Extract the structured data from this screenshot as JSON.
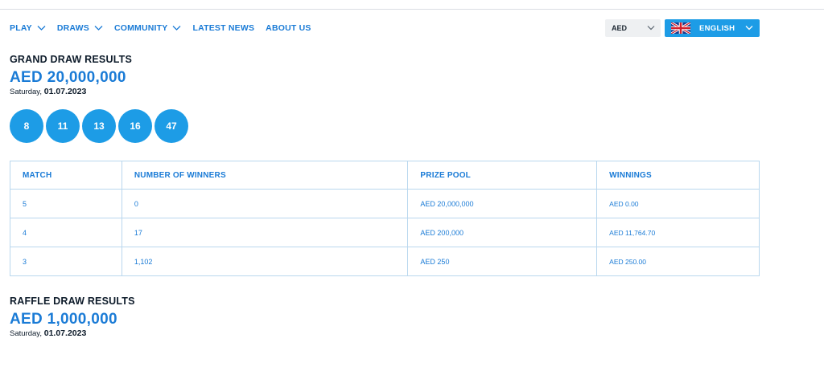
{
  "nav": {
    "items": [
      {
        "label": "PLAY",
        "has_dropdown": true
      },
      {
        "label": "DRAWS",
        "has_dropdown": true
      },
      {
        "label": "COMMUNITY",
        "has_dropdown": true
      },
      {
        "label": "LATEST NEWS",
        "has_dropdown": false
      },
      {
        "label": "ABOUT US",
        "has_dropdown": false
      }
    ],
    "currency": {
      "selected": "AED"
    },
    "language": {
      "selected": "ENGLISH",
      "flag_icon": "uk-flag-icon"
    }
  },
  "grand_draw": {
    "title": "GRAND DRAW RESULTS",
    "amount": "AED 20,000,000",
    "day": "Saturday,",
    "date": "01.07.2023",
    "numbers": [
      "8",
      "11",
      "13",
      "16",
      "47"
    ]
  },
  "results_table": {
    "headers": [
      "MATCH",
      "NUMBER OF WINNERS",
      "PRIZE POOL",
      "WINNINGS"
    ],
    "rows": [
      {
        "match": "5",
        "winners": "0",
        "prize_pool": "AED 20,000,000",
        "winnings": "AED 0.00"
      },
      {
        "match": "4",
        "winners": "17",
        "prize_pool": "AED 200,000",
        "winnings": "AED 11,764.70"
      },
      {
        "match": "3",
        "winners": "1,102",
        "prize_pool": "AED 250",
        "winnings": "AED 250.00"
      }
    ]
  },
  "raffle_draw": {
    "title": "RAFFLE DRAW RESULTS",
    "amount": "AED 1,000,000",
    "day": "Saturday,",
    "date": "01.07.2023"
  },
  "colors": {
    "accent": "#1a7bd6",
    "ball": "#1d9ce6",
    "border": "#b9d7ee",
    "heading": "#0d1b2a"
  }
}
